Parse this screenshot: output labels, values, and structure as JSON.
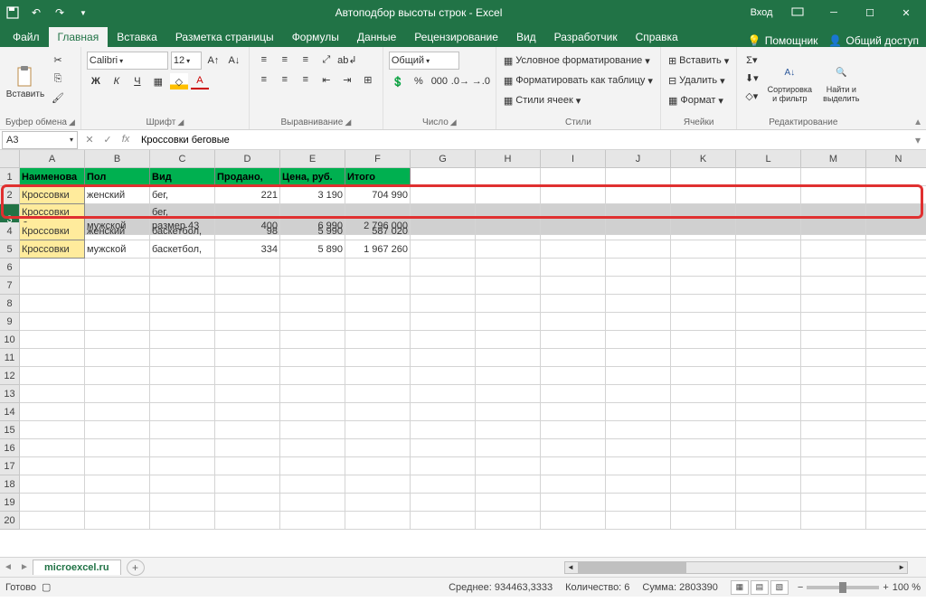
{
  "title": "Автоподбор высоты строк - Excel",
  "login": "Вход",
  "tabs": {
    "file": "Файл",
    "home": "Главная",
    "insert": "Вставка",
    "layout": "Разметка страницы",
    "formulas": "Формулы",
    "data": "Данные",
    "review": "Рецензирование",
    "view": "Вид",
    "developer": "Разработчик",
    "help": "Справка",
    "tellme": "Помощник",
    "share": "Общий доступ"
  },
  "ribbon": {
    "clipboard": {
      "label": "Буфер обмена",
      "paste": "Вставить"
    },
    "font": {
      "label": "Шрифт",
      "name": "Calibri",
      "size": "12"
    },
    "align": {
      "label": "Выравнивание"
    },
    "number": {
      "label": "Число",
      "format": "Общий"
    },
    "styles": {
      "label": "Стили",
      "cond": "Условное форматирование",
      "table": "Форматировать как таблицу",
      "cell": "Стили ячеек"
    },
    "cells": {
      "label": "Ячейки",
      "insert": "Вставить",
      "delete": "Удалить",
      "format": "Формат"
    },
    "editing": {
      "label": "Редактирование",
      "sort": "Сортировка и фильтр",
      "find": "Найти и выделить"
    }
  },
  "namebox": "A3",
  "formula": "Кроссовки беговые",
  "cols": [
    "A",
    "B",
    "C",
    "D",
    "E",
    "F",
    "G",
    "H",
    "I",
    "J",
    "K",
    "L",
    "M",
    "N"
  ],
  "headers": {
    "a": "Наименова",
    "b": "Пол",
    "c": "Вид",
    "d": "Продано,",
    "e": "Цена, руб.",
    "f": "Итого"
  },
  "rows": [
    {
      "a": "Кроссовки",
      "b": "женский",
      "c": "бег,",
      "d": "221",
      "e": "3 190",
      "f": "704 990"
    },
    {
      "a1": "Кроссовки",
      "a2": "беговые",
      "b": "мужской",
      "c1": "бег,",
      "c2": "размер 43",
      "d": "400",
      "e": "6 990",
      "f": "2 796 000"
    },
    {
      "a": "Кроссовки",
      "b": "женский",
      "c": "баскетбол,",
      "d": "98",
      "e": "5 990",
      "f": "587 020"
    },
    {
      "a": "Кроссовки",
      "b": "мужской",
      "c": "баскетбол,",
      "d": "334",
      "e": "5 890",
      "f": "1 967 260"
    }
  ],
  "sheet": "microexcel.ru",
  "status": {
    "ready": "Готово",
    "avg": "Среднее: 934463,3333",
    "count": "Количество: 6",
    "sum": "Сумма: 2803390",
    "zoom": "100 %"
  }
}
